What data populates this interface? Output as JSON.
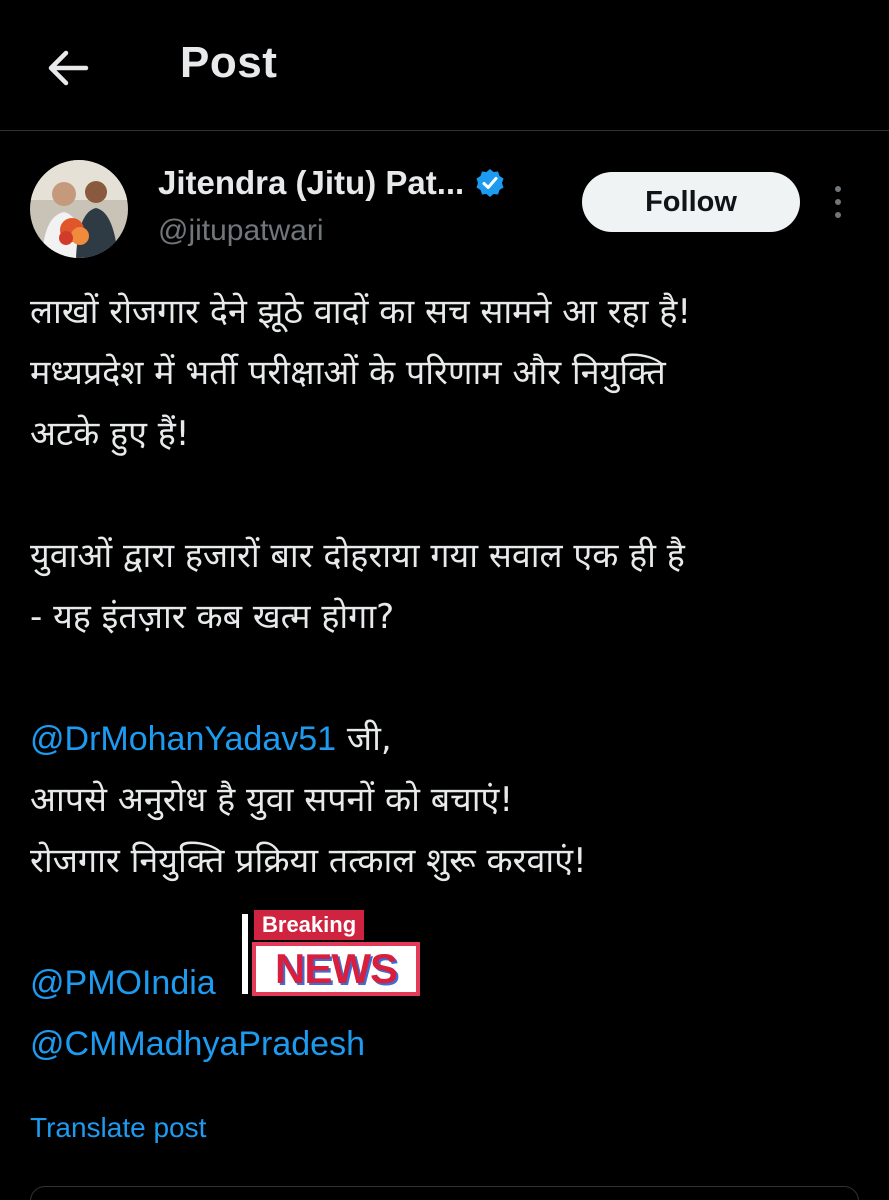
{
  "header": {
    "title": "Post"
  },
  "author": {
    "name": "Jitendra (Jitu) Pat...",
    "handle": "@jitupatwari",
    "verified": true
  },
  "follow_label": "Follow",
  "post": {
    "lines": [
      "लाखों रोजगार देने झूठे वादों का सच सामने आ रहा है!",
      "मध्यप्रदेश में भर्ती परीक्षाओं के परिणाम और नियुक्ति",
      "अटके हुए हैं!",
      "युवाओं द्वारा हजारों बार दोहराया गया सवाल एक ही है",
      "- यह इंतज़ार कब खत्म होगा?"
    ],
    "mention1": "@DrMohanYadav51",
    "mention1_suffix": " जी,",
    "line_after_1": "आपसे अनुरोध है युवा सपनों को बचाएं!",
    "line_after_2": "रोजगार नियुक्ति प्रक्रिया तत्काल शुरू करवाएं!",
    "mention2": "@PMOIndia",
    "mention3": "@CMMadhyaPradesh"
  },
  "translate_label": "Translate post",
  "overlay": {
    "top": "Breaking",
    "bottom": "NEWS"
  },
  "colors": {
    "background": "#000000",
    "link": "#1d9bf0",
    "verified": "#1d9bf0",
    "muted": "#71767b"
  }
}
